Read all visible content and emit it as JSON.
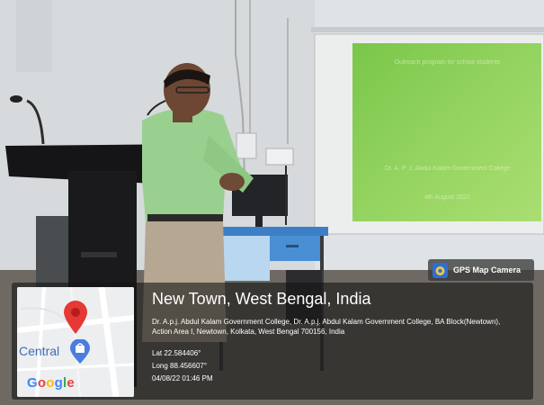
{
  "slide": {
    "lines": [
      "Outreach program for school students",
      "",
      "",
      "",
      "",
      "Dr. A. P. J. Abdul Kalam Government College",
      "4th August 2022"
    ]
  },
  "gps_badge": {
    "label": "GPS Map Camera",
    "icon": "gps-map-camera-icon"
  },
  "map": {
    "place_label": "Central",
    "logo_letters": [
      "G",
      "o",
      "o",
      "g",
      "l",
      "e"
    ],
    "logo_colors": [
      "#4285F4",
      "#EA4335",
      "#FBBC05",
      "#4285F4",
      "#34A853",
      "#EA4335"
    ],
    "pin_color": "#e53935",
    "marker_color": "#4a7de0"
  },
  "location": {
    "title": "New Town, West Bengal, India",
    "address": "Dr. A.p.j. Abdul Kalam Government College, Dr. A.p.j. Abdul Kalam Government College, BA Block(Newtown), Action Area I, Newtown, Kolkata, West Bengal 700156, India",
    "lat": "Lat 22.584406°",
    "long": "Long 88.456607°",
    "datetime": "04/08/22 01:46 PM"
  }
}
